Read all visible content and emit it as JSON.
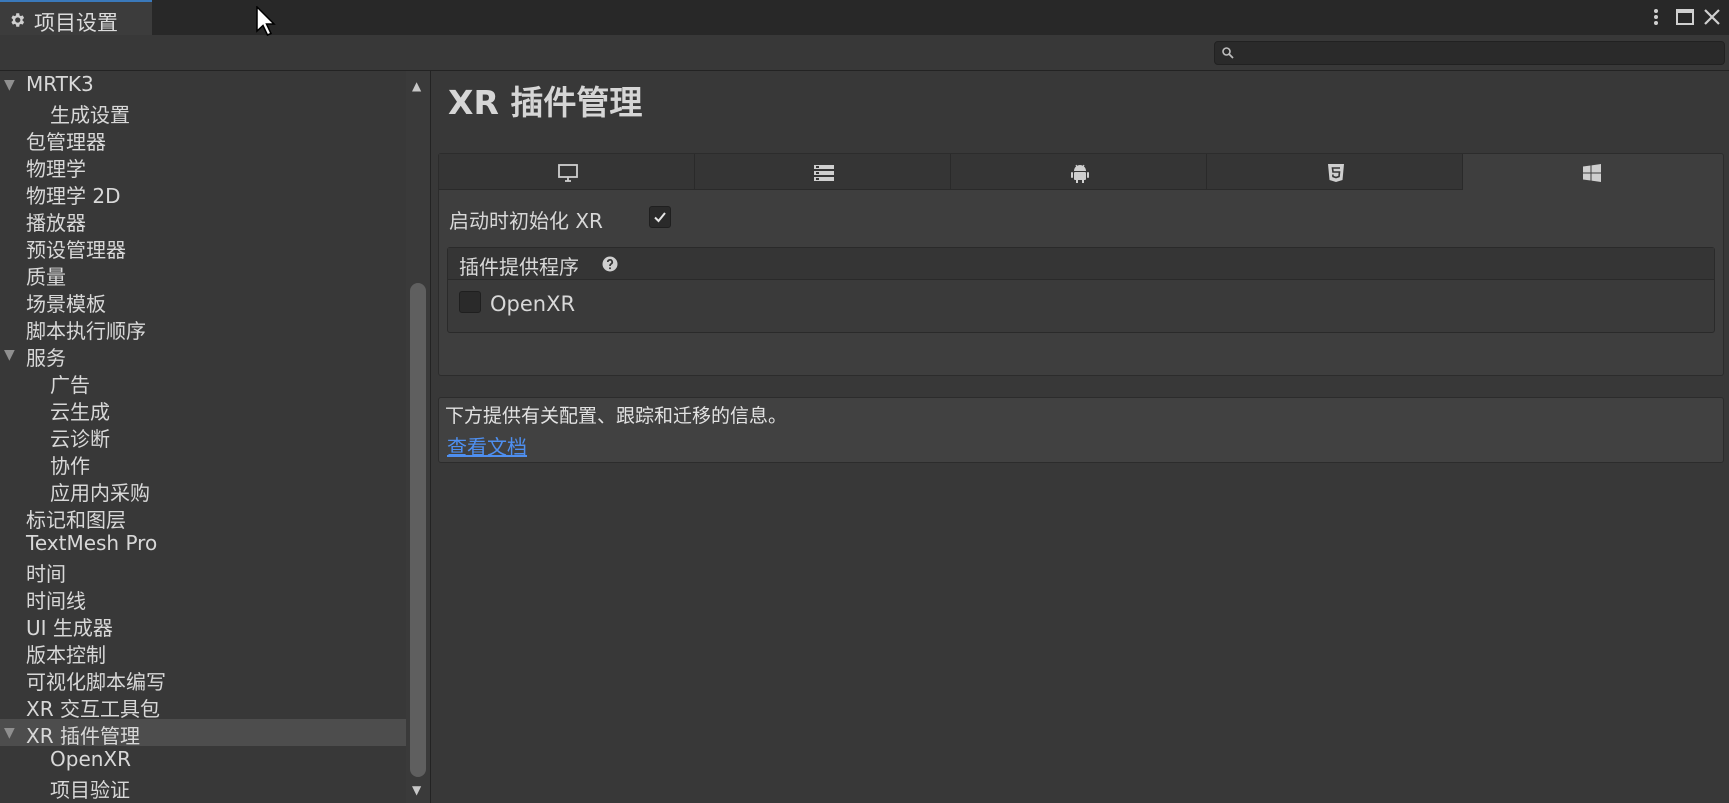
{
  "window": {
    "tab_label": "项目设置",
    "tab_icon": "gear-icon"
  },
  "toolbar": {
    "search_value": "",
    "search_icon": "search-icon"
  },
  "sidebar": {
    "items": [
      {
        "label": "MRTK3",
        "level": 0,
        "expanded": true
      },
      {
        "label": "生成设置",
        "level": 1
      },
      {
        "label": "包管理器",
        "level": 0
      },
      {
        "label": "物理学",
        "level": 0
      },
      {
        "label": "物理学 2D",
        "level": 0
      },
      {
        "label": "播放器",
        "level": 0
      },
      {
        "label": "预设管理器",
        "level": 0
      },
      {
        "label": "质量",
        "level": 0
      },
      {
        "label": "场景模板",
        "level": 0
      },
      {
        "label": "脚本执行顺序",
        "level": 0
      },
      {
        "label": "服务",
        "level": 0,
        "expanded": true
      },
      {
        "label": "广告",
        "level": 1
      },
      {
        "label": "云生成",
        "level": 1
      },
      {
        "label": "云诊断",
        "level": 1
      },
      {
        "label": "协作",
        "level": 1
      },
      {
        "label": "应用内采购",
        "level": 1
      },
      {
        "label": "标记和图层",
        "level": 0
      },
      {
        "label": "TextMesh Pro",
        "level": 0
      },
      {
        "label": "时间",
        "level": 0
      },
      {
        "label": "时间线",
        "level": 0
      },
      {
        "label": "UI 生成器",
        "level": 0
      },
      {
        "label": "版本控制",
        "level": 0
      },
      {
        "label": "可视化脚本编写",
        "level": 0
      },
      {
        "label": "XR 交互工具包",
        "level": 0
      },
      {
        "label": "XR 插件管理",
        "level": 0,
        "expanded": true,
        "selected": true
      },
      {
        "label": "OpenXR",
        "level": 1
      },
      {
        "label": "项目验证",
        "level": 1
      }
    ]
  },
  "main": {
    "title": "XR 插件管理",
    "platform_tabs": [
      {
        "icon": "desktop-icon",
        "active": false
      },
      {
        "icon": "server-icon",
        "active": false
      },
      {
        "icon": "android-icon",
        "active": false
      },
      {
        "icon": "html5-icon",
        "active": false
      },
      {
        "icon": "windows-icon",
        "active": true
      }
    ],
    "init_xr_label": "启动时初始化 XR",
    "init_xr_checked": true,
    "providers_title": "插件提供程序",
    "providers": [
      {
        "label": "OpenXR",
        "checked": false
      }
    ],
    "info_text": "下方提供有关配置、跟踪和迁移的信息。",
    "info_link": "查看文档"
  },
  "colors": {
    "background": "#383838",
    "titlebar": "#282828",
    "link": "#4e8ff0",
    "tab_accent": "#3a79bb",
    "selected_row": "#4d4d4d"
  }
}
